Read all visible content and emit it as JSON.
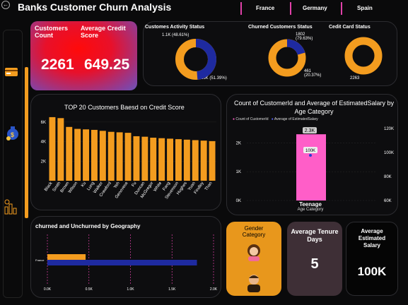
{
  "header": {
    "title": "Banks Customer Churn Analysis",
    "tabs": [
      "France",
      "Germany",
      "Spain"
    ]
  },
  "sidebar": {
    "icons": [
      "credit-card-icon",
      "money-bag-icon",
      "bar-chart-icon"
    ]
  },
  "kpi": {
    "customers_label": "Customers Count",
    "customers_value": "2261",
    "credit_label": "Average Credit Score",
    "credit_value": "649.25"
  },
  "donuts": {
    "activity": {
      "title": "Customes Activity Status",
      "label_a": "1.1K (48.61%)",
      "label_b": "1.16K (51.39%)",
      "fraction": 0.4861
    },
    "churned": {
      "title": "Churned Customers Status",
      "label_a": "1802 (79.63%)",
      "label_b": "461 (20.37%)",
      "fraction": 0.2037
    },
    "credit_card": {
      "title": "Cedit Card Status",
      "label_a": "2263",
      "fraction": 1.0
    }
  },
  "colors": {
    "orange": "#f39c1f",
    "navy": "#1e2aa0",
    "pink": "#ff5ec8",
    "accent": "#e040a8"
  },
  "top20": {
    "title": "TOP 20 Customers Baesd on Credit Score"
  },
  "age": {
    "title": "Count of CustomerId and Average of EstimatedSalary by Age Category",
    "legend_a": "Count of CustomerId",
    "legend_b": "Average of EstimatedSalary",
    "count_label": "2.3K",
    "salary_label": "100K",
    "category": "Teenage",
    "xlabel": "Age Category"
  },
  "geo": {
    "title": "churned and Unchurned by Geography",
    "row_label": "France"
  },
  "cards": {
    "gender_label": "Gender Category",
    "tenure_label": "Average Tenure Days",
    "tenure_value": "5",
    "salary_label": "Average Estimated Salary",
    "salary_value": "100K"
  },
  "chart_data": [
    {
      "type": "bar",
      "title": "TOP 20 Customers Baesd on Credit Score",
      "categories": [
        "Black",
        "Smith",
        "Brown",
        "Wilson",
        "Ku",
        "Lung",
        "Walker",
        "Crawford",
        "Yeh",
        "Genovese",
        "Fu",
        "Duncan",
        "McGregor",
        "White",
        "Fang",
        "Stevenson",
        "Hughes",
        "Yuan",
        "Findley",
        "Than"
      ],
      "values": [
        6500,
        6400,
        5500,
        5300,
        5250,
        5200,
        5100,
        5000,
        4950,
        4900,
        4550,
        4500,
        4400,
        4350,
        4300,
        4250,
        4200,
        4150,
        4100,
        4050
      ],
      "yticks": [
        "2K",
        "4K",
        "6K"
      ],
      "ylim": [
        0,
        7000
      ]
    },
    {
      "type": "bar",
      "title": "Count of CustomerId and Average of EstimatedSalary by Age Category",
      "categories": [
        "Teenage"
      ],
      "series": [
        {
          "name": "Count of CustomerId",
          "values": [
            2300
          ]
        },
        {
          "name": "Average of EstimatedSalary",
          "values": [
            100000
          ]
        }
      ],
      "y_left_ticks": [
        "0K",
        "1K",
        "2K"
      ],
      "y_right_ticks": [
        "60K",
        "80K",
        "100K",
        "120K"
      ],
      "xlabel": "Age Category"
    },
    {
      "type": "bar",
      "title": "churned and Unchurned by Geography",
      "categories": [
        "France"
      ],
      "series": [
        {
          "name": "churned",
          "values": [
            460
          ]
        },
        {
          "name": "unchurned",
          "values": [
            1800
          ]
        }
      ],
      "xticks": [
        "0.0K",
        "0.5K",
        "1.0K",
        "1.5K",
        "2.0K"
      ],
      "xlim": [
        0,
        2000
      ]
    }
  ]
}
